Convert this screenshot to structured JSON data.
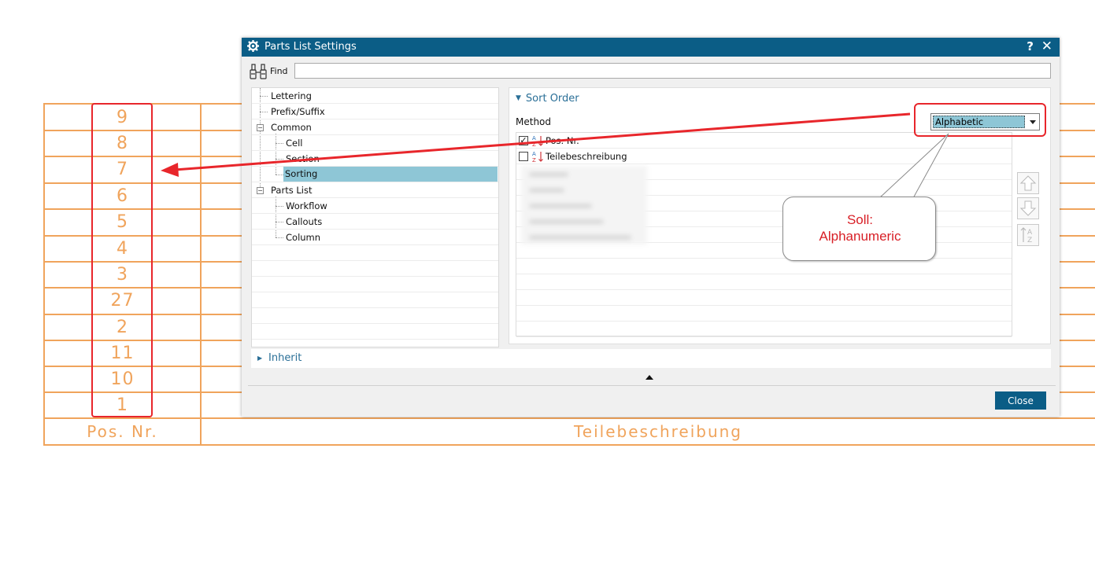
{
  "parts_table": {
    "positions": [
      "9",
      "8",
      "7",
      "6",
      "5",
      "4",
      "3",
      "27",
      "2",
      "11",
      "10",
      "1"
    ],
    "header_pos": "Pos. Nr.",
    "header_desc": "Teilebeschreibung"
  },
  "dialog": {
    "title": "Parts List Settings",
    "help_label": "?",
    "close_x": "✕",
    "find_label": "Find",
    "find_value": "",
    "tree": [
      {
        "label": "Lettering",
        "level": 0
      },
      {
        "label": "Prefix/Suffix",
        "level": 0
      },
      {
        "label": "Common",
        "level": 0,
        "expander": "−"
      },
      {
        "label": "Cell",
        "level": 1
      },
      {
        "label": "Section",
        "level": 1
      },
      {
        "label": "Sorting",
        "level": 1,
        "selected": true
      },
      {
        "label": "Parts List",
        "level": 0,
        "expander": "−"
      },
      {
        "label": "Workflow",
        "level": 1
      },
      {
        "label": "Callouts",
        "level": 1
      },
      {
        "label": "Column",
        "level": 1
      }
    ],
    "sort_order": {
      "heading": "Sort Order",
      "method_label": "Method",
      "method_value": "Alphabetic",
      "items": [
        {
          "label": "Pos. Nr.",
          "checked": true
        },
        {
          "label": "Teilebeschreibung",
          "checked": false
        }
      ]
    },
    "inherit_label": "Inherit",
    "close_button": "Close"
  },
  "annotation": {
    "callout_line1": "Soll:",
    "callout_line2": "Alphanumeric",
    "color": "#e8262b"
  },
  "colors": {
    "titlebar": "#0b5d86",
    "table_lines": "#f0a45c",
    "selection": "#8ec6d6",
    "accent_text": "#2a6f97"
  }
}
